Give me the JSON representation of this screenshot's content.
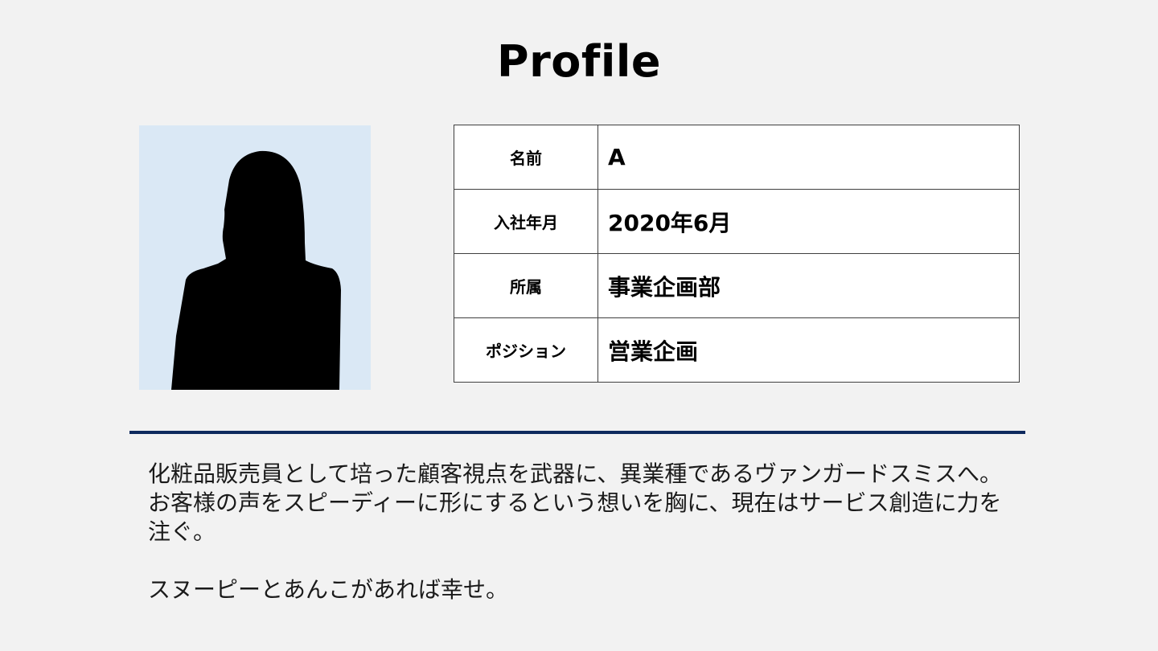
{
  "page": {
    "title": "Profile"
  },
  "profile": {
    "rows": [
      {
        "label": "名前",
        "value": "A"
      },
      {
        "label": "入社年月",
        "value": "2020年6月"
      },
      {
        "label": "所属",
        "value": "事業企画部"
      },
      {
        "label": "ポジション",
        "value": "営業企画"
      }
    ]
  },
  "bio": {
    "paragraph": "化粧品販売員として培った顧客視点を武器に、異業種であるヴァンガードスミスへ。お客様の声をスピーディーに形にするという想いを胸に、現在はサービス創造に力を注ぐ。",
    "note": "スヌーピーとあんこがあれば幸せ。"
  },
  "colors": {
    "background": "#f2f2f2",
    "photo_background": "#dae8f5",
    "divider": "#0e2a5e",
    "silhouette": "#000000"
  },
  "icons": {
    "photo": "person-silhouette-icon"
  }
}
